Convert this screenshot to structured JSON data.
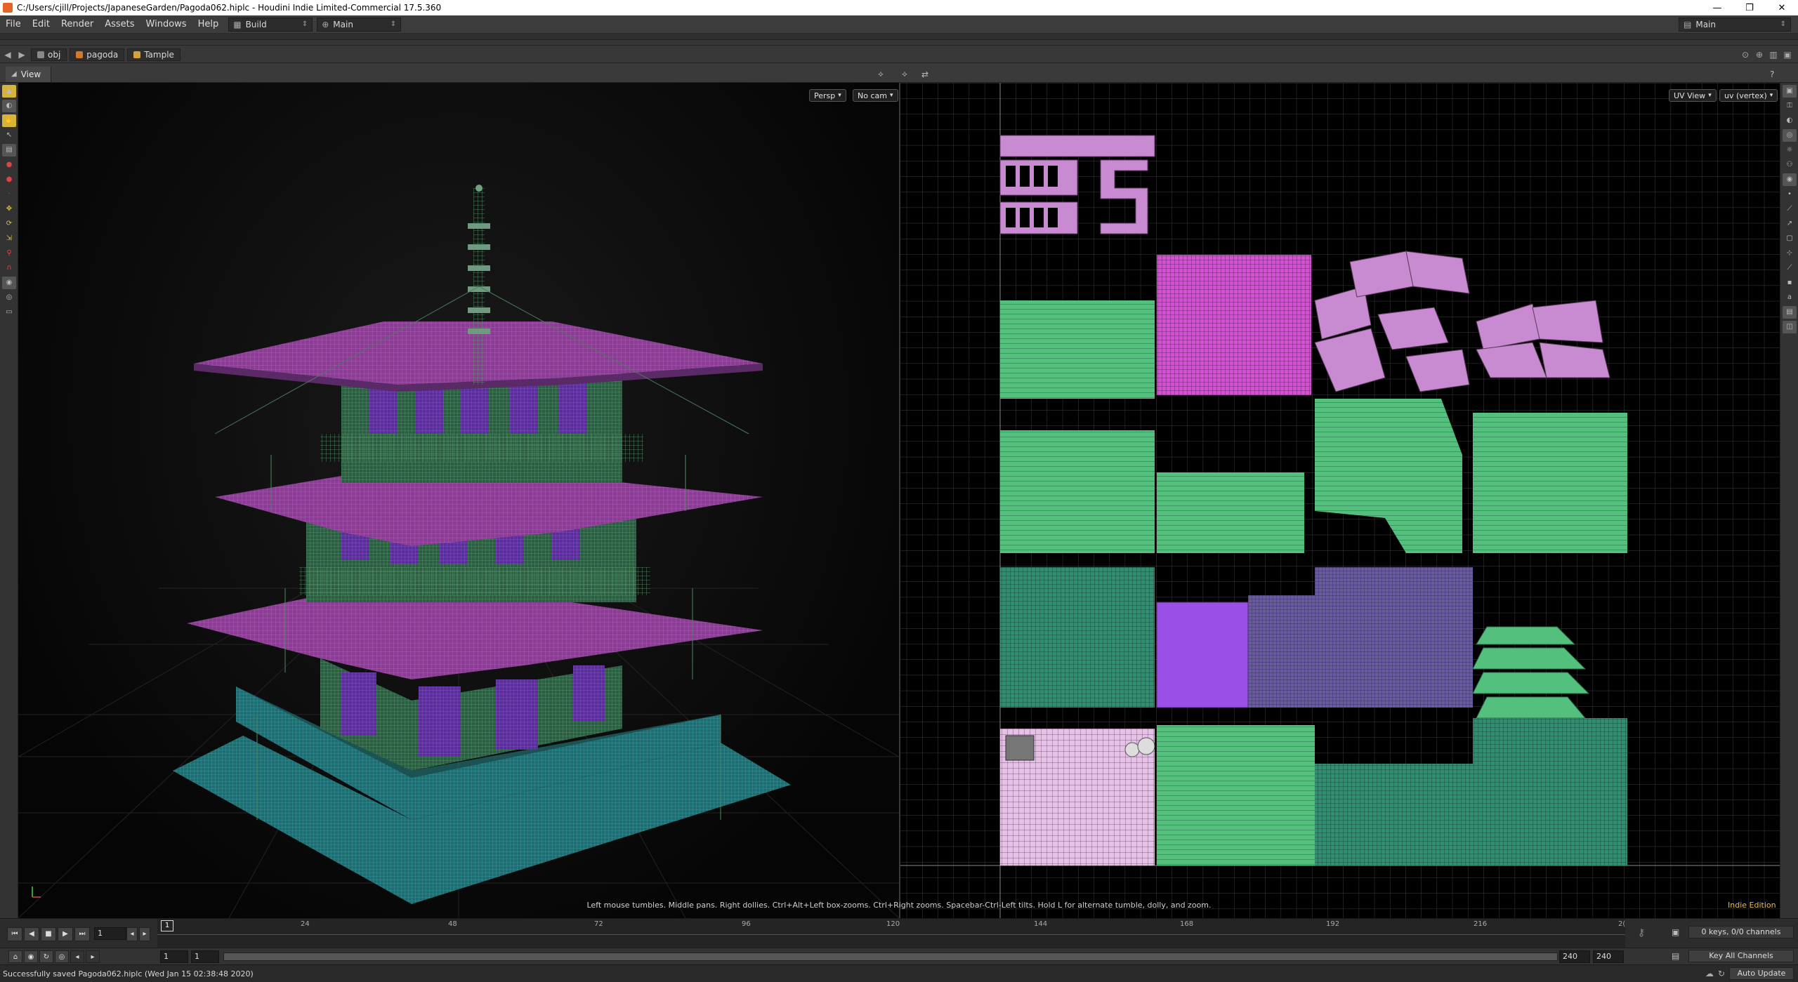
{
  "window": {
    "title": "C:/Users/cjill/Projects/JapaneseGarden/Pagoda062.hiplc - Houdini Indie Limited-Commercial 17.5.360",
    "controls": [
      "—",
      "❐",
      "✕"
    ]
  },
  "menubar": {
    "items": [
      "File",
      "Edit",
      "Render",
      "Assets",
      "Windows",
      "Help"
    ],
    "desktop": "Build",
    "workspace": "Main",
    "right_workspace": "Main"
  },
  "pathbar": {
    "crumbs": [
      "obj",
      "pagoda",
      "Tample"
    ]
  },
  "pane": {
    "tab_label": "View"
  },
  "viewport3d": {
    "camera_menu": "Persp",
    "cam_menu": "No cam"
  },
  "viewportuv": {
    "view_menu": "UV View",
    "attrib_menu": "uv (vertex)"
  },
  "hint_text": "Left mouse tumbles. Middle pans. Right dollies. Ctrl+Alt+Left box-zooms. Ctrl+Right zooms. Spacebar-Ctrl-Left tilts. Hold L for alternate tumble, dolly, and zoom.",
  "edition_label": "Indie Edition",
  "timeline": {
    "current_frame": "1",
    "marker": "1",
    "ticks": [
      "24",
      "48",
      "72",
      "96",
      "120",
      "144",
      "168",
      "192",
      "216",
      "2("
    ],
    "keys_info": "0 keys, 0/0 channels",
    "key_all": "Key All Channels"
  },
  "range": {
    "start": "1",
    "start2": "1",
    "end": "240",
    "end2": "240"
  },
  "status": {
    "message": "Successfully saved Pagoda062.hiplc (Wed Jan 15 02:38:48 2020)",
    "auto_update": "Auto Update"
  },
  "colors": {
    "uv_green": "#4fbf7a",
    "uv_pink": "#c88ad0",
    "uv_magenta": "#d64fd6",
    "uv_teal": "#2e8a6e",
    "roof_pink": "#9b3fa0",
    "base_teal": "#2a8f8f"
  }
}
